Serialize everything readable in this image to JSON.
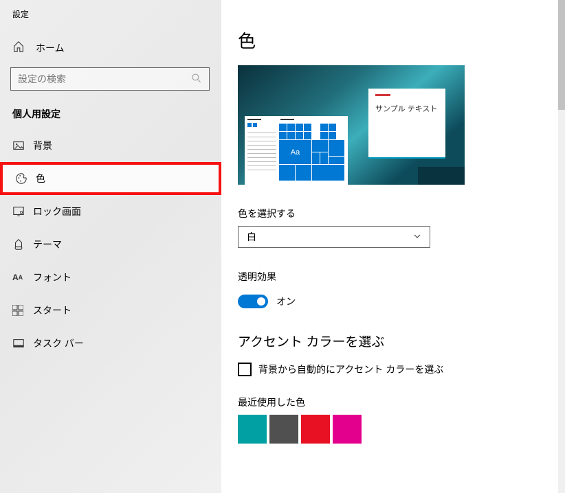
{
  "window": {
    "title": "設定"
  },
  "home": {
    "label": "ホーム"
  },
  "search": {
    "placeholder": "設定の検索"
  },
  "section": {
    "header": "個人用設定"
  },
  "nav": {
    "items": [
      {
        "label": "背景"
      },
      {
        "label": "色"
      },
      {
        "label": "ロック画面"
      },
      {
        "label": "テーマ"
      },
      {
        "label": "フォント"
      },
      {
        "label": "スタート"
      },
      {
        "label": "タスク バー"
      }
    ]
  },
  "page": {
    "title": "色"
  },
  "preview": {
    "sample_text": "サンプル テキスト",
    "tile_aa": "Aa"
  },
  "color_select": {
    "label": "色を選択する",
    "value": "白"
  },
  "transparency": {
    "label": "透明効果",
    "state": "オン"
  },
  "accent": {
    "heading": "アクセント カラーを選ぶ",
    "auto_label": "背景から自動的にアクセント カラーを選ぶ",
    "recent_label": "最近使用した色",
    "recent_colors": [
      "#00a0a3",
      "#505050",
      "#e81123",
      "#e3008c"
    ]
  }
}
